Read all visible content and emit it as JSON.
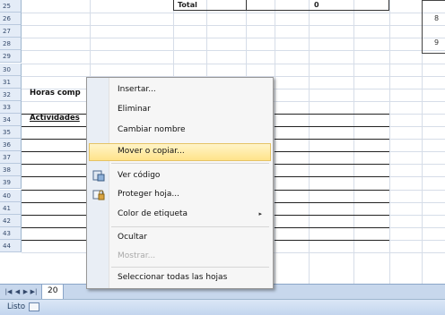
{
  "grid": {
    "row_numbers": [
      "25",
      "26",
      "27",
      "28",
      "29",
      "30",
      "31",
      "32",
      "33",
      "34",
      "35",
      "36",
      "37",
      "38",
      "39",
      "40",
      "41",
      "42",
      "43",
      "44"
    ],
    "total_label": "Total",
    "total_value": "0",
    "cell_a31": "Horas comp",
    "cell_a33": "Actividades",
    "side_labels": [
      "8",
      "9"
    ]
  },
  "context_menu": {
    "items": [
      {
        "label": "Insertar...",
        "disabled": false
      },
      {
        "label": "Eliminar",
        "disabled": false
      },
      {
        "label": "Cambiar nombre",
        "disabled": false
      },
      {
        "label": "Mover o copiar...",
        "disabled": false,
        "highlighted": true
      },
      {
        "label": "Ver código",
        "disabled": false,
        "icon": "view-code-icon"
      },
      {
        "label": "Proteger hoja...",
        "disabled": false,
        "icon": "protect-sheet-icon"
      },
      {
        "label": "Color de etiqueta",
        "disabled": false,
        "submenu": true
      },
      {
        "label": "Ocultar",
        "disabled": false
      },
      {
        "label": "Mostrar...",
        "disabled": true
      },
      {
        "label": "Seleccionar todas las hojas",
        "disabled": false
      }
    ],
    "submenu_arrow": "▸"
  },
  "sheet_tabs": {
    "nav_buttons": [
      "first-sheet-icon",
      "previous-sheet-icon",
      "next-sheet-icon",
      "last-sheet-icon"
    ],
    "active_tab": "20"
  },
  "status_bar": {
    "text": "Listo"
  },
  "colors": {
    "highlight": "#ffe38a",
    "tab_bar": "#c7d7ec",
    "row_header": "#e4ecf7"
  }
}
